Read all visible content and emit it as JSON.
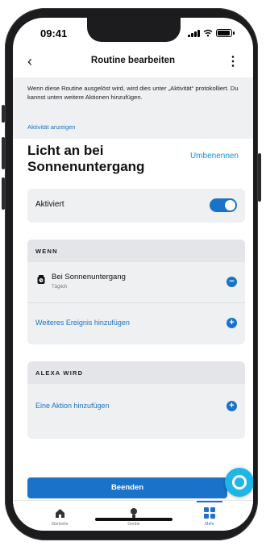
{
  "status_bar": {
    "time": "09:41"
  },
  "header": {
    "back_icon": "chevron-left-icon",
    "title": "Routine bearbeiten",
    "more_icon": "more-vertical-icon"
  },
  "info": {
    "text": "Wenn diese Routine ausgelöst wird, wird dies unter „Aktivität“ protokolliert. Du kannst unten weitere Aktionen hinzufügen.",
    "link": "Aktivität anzeigen"
  },
  "routine": {
    "name": "Licht an bei Sonnenuntergang",
    "rename_label": "Umbenennen"
  },
  "active": {
    "label": "Aktiviert",
    "enabled": true
  },
  "when": {
    "title": "WENN",
    "event": {
      "title": "Bei Sonnenuntergang",
      "subtitle": "Täglich",
      "icon": "clock-icon",
      "action_icon": "remove-circle-icon"
    },
    "add_label": "Weiteres Ereignis hinzufügen",
    "add_icon": "add-circle-icon"
  },
  "alexa": {
    "title": "ALEXA WIRD",
    "add_label": "Eine Aktion hinzufügen",
    "add_icon": "add-circle-icon"
  },
  "done_button": "Beenden",
  "tabs": [
    {
      "label": "Startseite",
      "icon": "home-icon"
    },
    {
      "label": "Geräte",
      "icon": "lightbulb-icon"
    },
    {
      "label": "Mehr",
      "icon": "grid-icon",
      "active": true
    }
  ],
  "colors": {
    "accent": "#1a73c9",
    "alexa": "#1fb6e6",
    "panel": "#eef0f2"
  }
}
